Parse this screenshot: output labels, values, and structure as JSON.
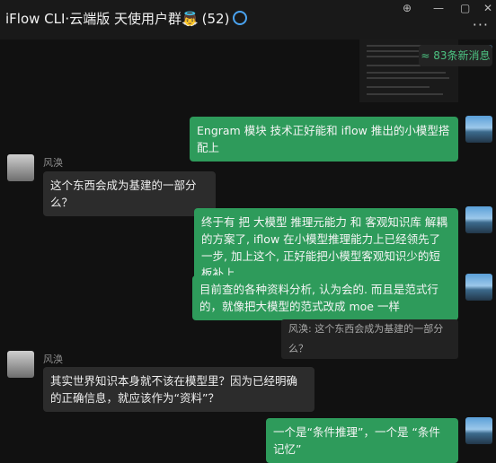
{
  "header": {
    "title": "iFlow CLI·云端版 天使用户群👼",
    "count": "(52)"
  },
  "window_controls": {
    "pin": "⊕",
    "minimize": "—",
    "maximize": "▢",
    "close": "✕",
    "more": "···"
  },
  "new_messages_label": "≈ 83条新消息",
  "messages": [
    {
      "text": "Engram 模块 技术正好能和 iflow 推出的小模型搭配上"
    },
    {
      "sender": "风涣",
      "text": "这个东西会成为基建的一部分么？"
    },
    {
      "text": "终于有 把 大模型 推理元能力 和 客观知识库 解耦的方案了, iflow 在小模型推理能力上已经领先了一步, 加上这个, 正好能把小模型客观知识少的短板补上"
    },
    {
      "text": "目前查的各种资料分析, 认为会的. 而且是范式行的，就像把大模型的范式改成 moe 一样",
      "quote": "风涣: 这个东西会成为基建的一部分么？"
    },
    {
      "sender": "风涣",
      "text": "其实世界知识本身就不该在模型里？因为已经明确的正确信息，就应该作为“资料”？"
    },
    {
      "text": "一个是“条件推理”，一个是 “条件记忆”"
    }
  ]
}
